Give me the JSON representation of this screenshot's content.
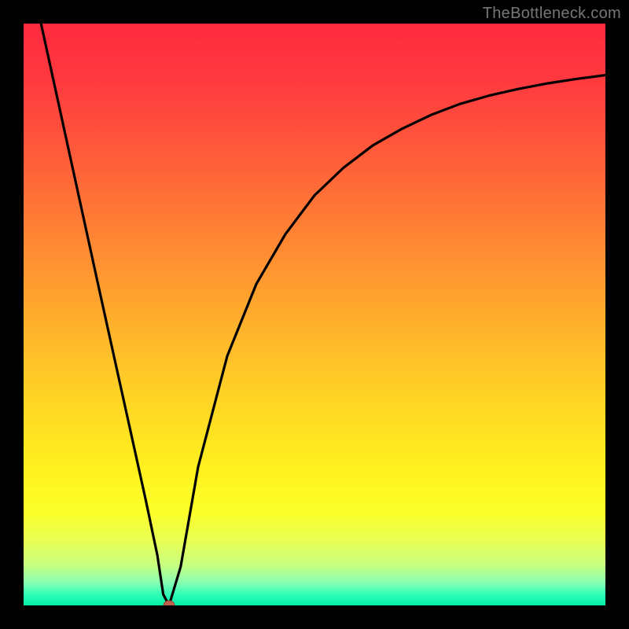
{
  "watermark": "TheBottleneck.com",
  "colors": {
    "curve_stroke": "#000000",
    "minimum_marker_fill": "#c06050",
    "minimum_marker_stroke": "#a04030"
  },
  "chart_data": {
    "type": "line",
    "title": "",
    "xlabel": "",
    "ylabel": "",
    "xlim": [
      0,
      100
    ],
    "ylim": [
      0,
      105
    ],
    "grid": false,
    "x": [
      3,
      8,
      13,
      17,
      21,
      23,
      24,
      25,
      27,
      30,
      35,
      40,
      45,
      50,
      55,
      60,
      65,
      70,
      75,
      80,
      85,
      90,
      95,
      100
    ],
    "y": [
      105,
      81,
      57,
      38,
      19,
      9,
      2,
      0,
      7,
      25,
      45,
      58,
      67,
      74,
      79,
      83,
      86,
      88.5,
      90.5,
      92,
      93.2,
      94.2,
      95,
      95.7
    ],
    "minimum_point": {
      "x": 25,
      "y": 0
    },
    "annotations": []
  }
}
